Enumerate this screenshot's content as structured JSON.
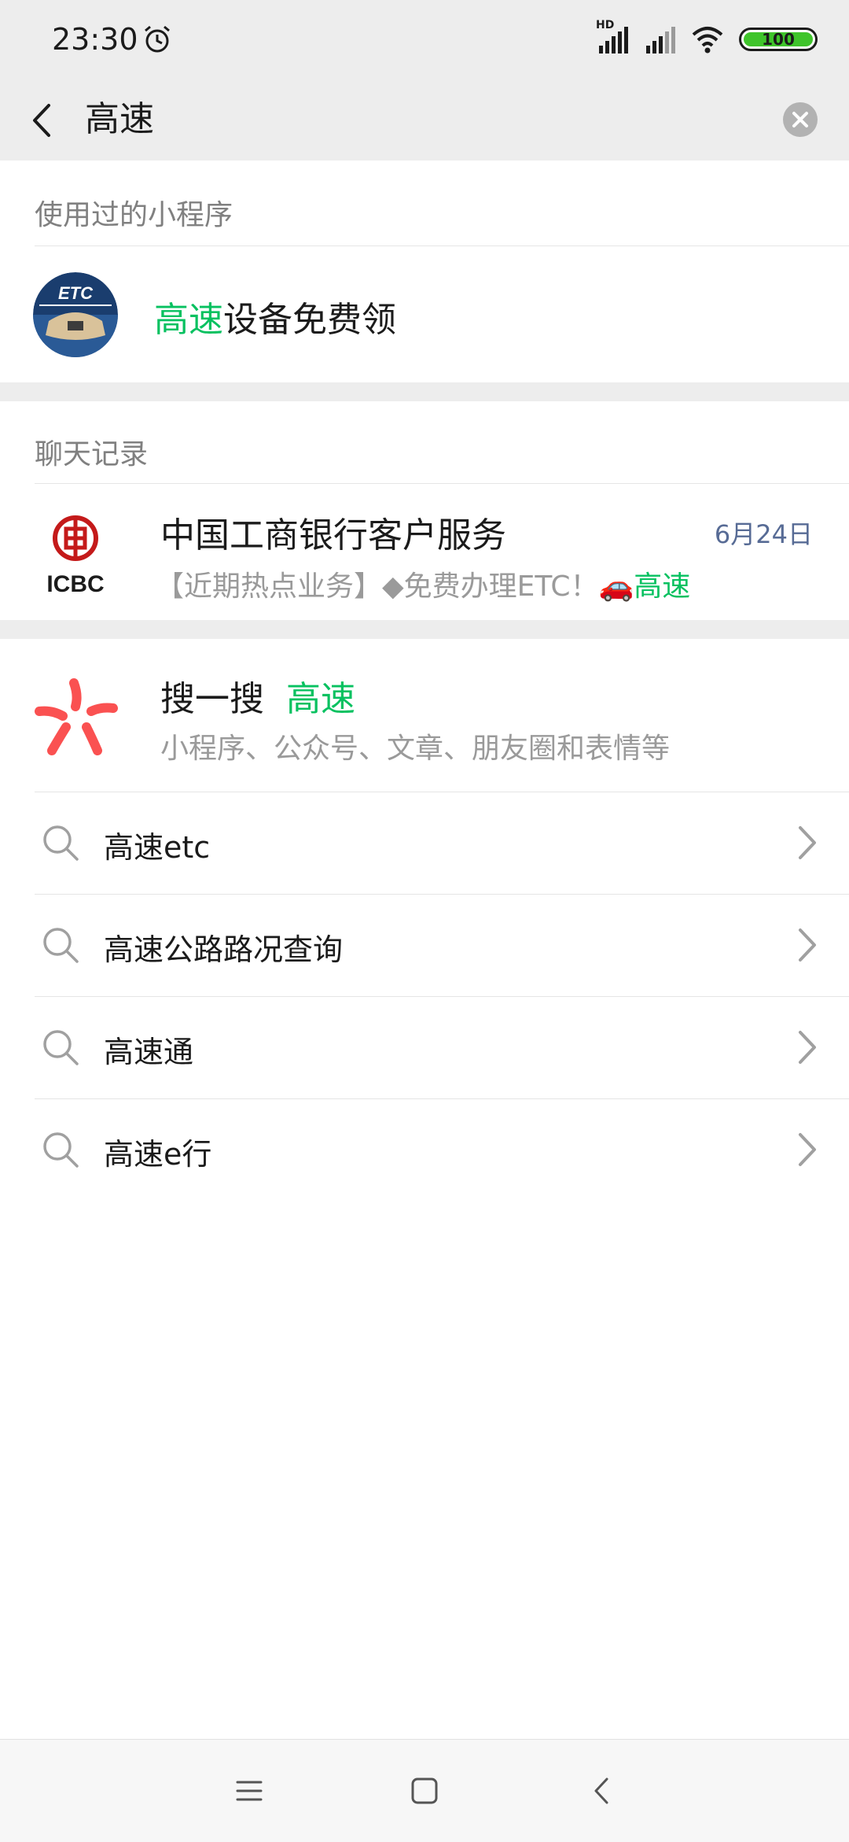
{
  "status_bar": {
    "time": "23:30",
    "hd_label": "HD",
    "battery": "100"
  },
  "search": {
    "query": "高速"
  },
  "mini_programs": {
    "section_title": "使用过的小程序",
    "items": [
      {
        "highlight": "高速",
        "rest": "设备免费领",
        "icon_text": "ETC"
      }
    ]
  },
  "chat_records": {
    "section_title": "聊天记录",
    "items": [
      {
        "name": "中国工商银行客户服务",
        "date": "6月24日",
        "preview_prefix": "【近期热点业务】◆免费办理ETC！",
        "preview_emoji": "🚗",
        "preview_highlight": "高速",
        "icon_text": "ICBC"
      }
    ]
  },
  "sou_yi_sou": {
    "label": "搜一搜",
    "highlight": "高速",
    "subtitle": "小程序、公众号、文章、朋友圈和表情等"
  },
  "suggestions": [
    {
      "text": "高速etc"
    },
    {
      "text": "高速公路路况查询"
    },
    {
      "text": "高速通"
    },
    {
      "text": "高速e行"
    }
  ],
  "colors": {
    "highlight": "#07c160",
    "date": "#576b95",
    "sou_icon": "#fa5151"
  }
}
